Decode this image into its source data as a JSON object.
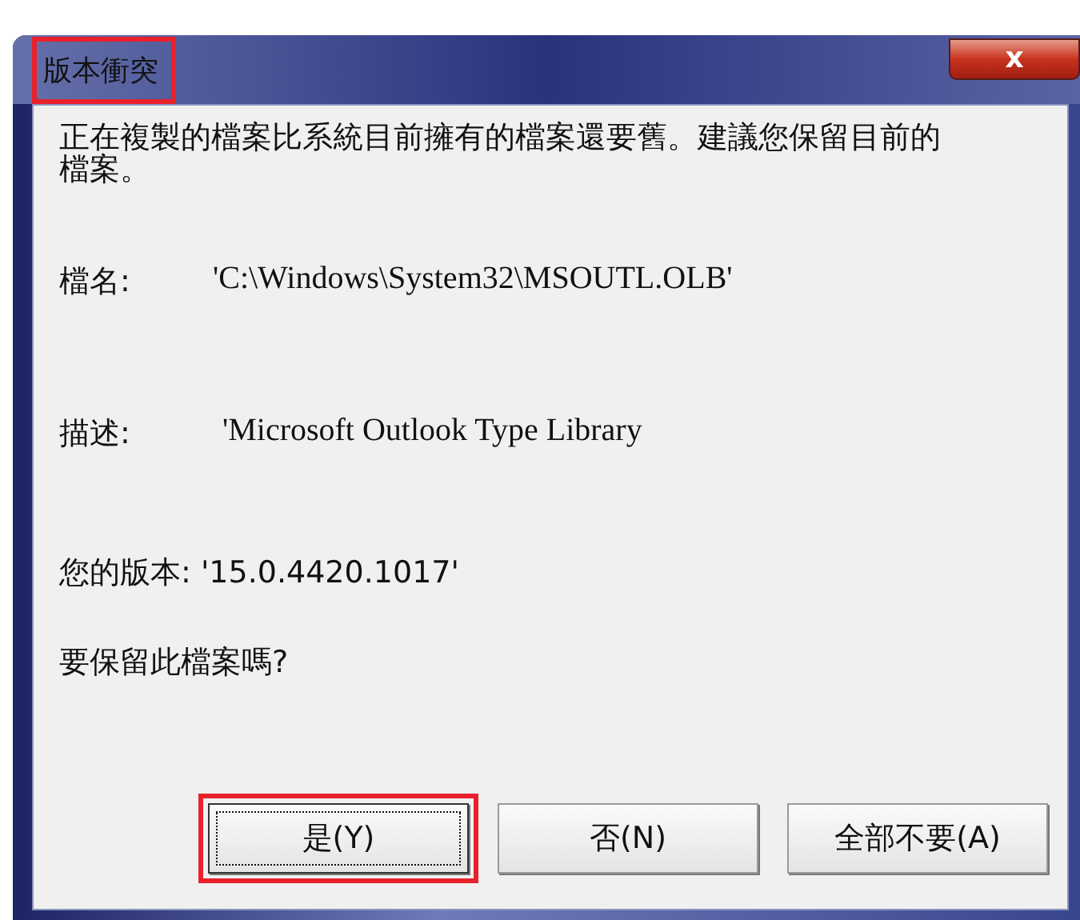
{
  "window": {
    "title": "版本衝突",
    "title_highlighted": true,
    "close": "x"
  },
  "message": "正在複製的檔案比系統目前擁有的檔案還要舊。建議您保留目前的檔案。",
  "fields": [
    {
      "label": "檔名:",
      "value": "'C:\\Windows\\System32\\MSOUTL.OLB'"
    },
    {
      "label": "描述:",
      "value": "'Microsoft Outlook Type Library"
    }
  ],
  "version": "您的版本: '15.0.4420.1017'",
  "question": "要保留此檔案嗎?",
  "buttons": [
    {
      "label": "是(Y)",
      "focused": true,
      "highlighted": true
    },
    {
      "label": "否(N)",
      "focused": false,
      "highlighted": false
    },
    {
      "label": "全部不要(A)",
      "focused": false,
      "highlighted": false
    }
  ]
}
